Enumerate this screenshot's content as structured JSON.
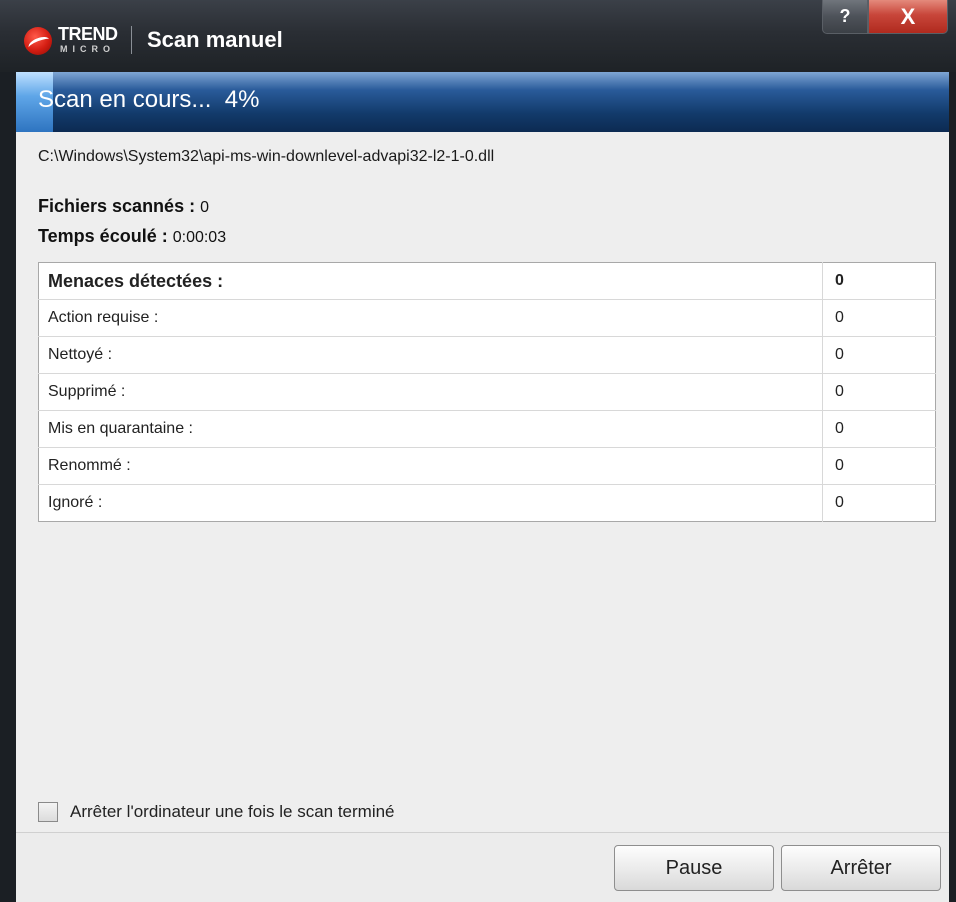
{
  "window": {
    "title": "Scan manuel",
    "logo": {
      "brand": "TREND",
      "sub": "MICRO"
    },
    "help_label": "?",
    "close_label": "X"
  },
  "progress": {
    "label": "Scan en cours...",
    "percent_text": "4%",
    "percent": 4
  },
  "current_file": "C:\\Windows\\System32\\api-ms-win-downlevel-advapi32-l2-1-0.dll",
  "stats": {
    "files_label": "Fichiers scannés :",
    "files_value": "0",
    "time_label": "Temps écoulé :",
    "time_value": "0:00:03"
  },
  "results": {
    "header": {
      "label": "Menaces détectées :",
      "value": "0"
    },
    "rows": [
      {
        "label": "Action requise :",
        "value": "0"
      },
      {
        "label": "Nettoyé :",
        "value": "0"
      },
      {
        "label": "Supprimé :",
        "value": "0"
      },
      {
        "label": "Mis en quarantaine :",
        "value": "0"
      },
      {
        "label": "Renommé :",
        "value": "0"
      },
      {
        "label": "Ignoré :",
        "value": "0"
      }
    ]
  },
  "shutdown_option": {
    "label": "Arrêter l'ordinateur une fois le scan terminé",
    "checked": false
  },
  "buttons": {
    "pause": "Pause",
    "stop": "Arrêter"
  },
  "colors": {
    "titlebar": "#2a2e34",
    "progress_bar": "#123a6a",
    "close_button": "#c8463a"
  }
}
